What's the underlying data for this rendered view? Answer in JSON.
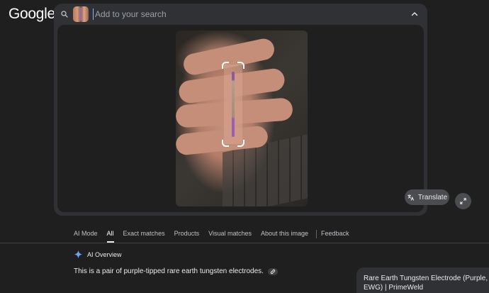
{
  "logo": {
    "text": "Google"
  },
  "search": {
    "placeholder": "Add to your search",
    "value": ""
  },
  "image_actions": {
    "translate_label": "Translate"
  },
  "tabs": [
    {
      "label": "AI Mode",
      "active": false
    },
    {
      "label": "All",
      "active": true
    },
    {
      "label": "Exact matches",
      "active": false
    },
    {
      "label": "Products",
      "active": false
    },
    {
      "label": "Visual matches",
      "active": false
    },
    {
      "label": "About this image",
      "active": false
    },
    {
      "label": "Feedback",
      "active": false
    }
  ],
  "ai_overview": {
    "title": "AI Overview",
    "answer": "This is a pair of purple-tipped rare earth tungsten electrodes."
  },
  "side_result": {
    "title": "Rare Earth Tungsten Electrode (Purple, EWG) | PrimeWeld"
  },
  "colors": {
    "background": "#1f1f1f",
    "panel": "#303134",
    "accent": "#8ab4f8"
  },
  "icons": {
    "search": "search-icon",
    "collapse": "chevron-up-icon",
    "translate": "translate-icon",
    "expand": "expand-icon",
    "sparkle": "gemini-sparkle-icon",
    "link": "link-icon"
  }
}
